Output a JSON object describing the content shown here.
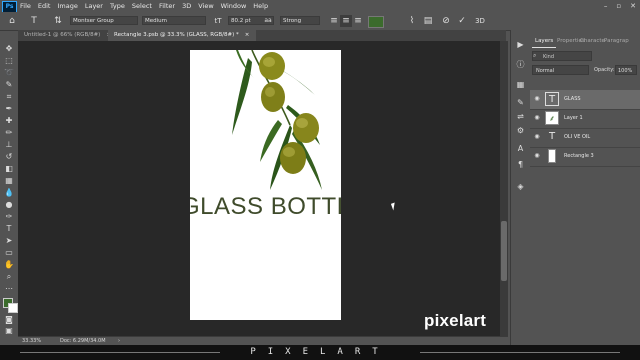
{
  "menubar": {
    "app_badge": "Ps",
    "items": [
      "File",
      "Edit",
      "Image",
      "Layer",
      "Type",
      "Select",
      "Filter",
      "3D",
      "View",
      "Window",
      "Help"
    ]
  },
  "options_bar": {
    "font_family": "Montser",
    "font_group": "Group",
    "font_style": "Medium",
    "font_size": "80.2 pt",
    "antialias": "Strong",
    "font_color": "#3b6b2c"
  },
  "tabs": [
    {
      "label": "Untitled-1 @ 66% (RGB/8#)",
      "close": "×",
      "active": false
    },
    {
      "label": "Rectangle 3.psb @ 33.3% (GLASS, RGB/8#) *",
      "close": "×",
      "active": true
    }
  ],
  "canvas": {
    "headline": "GLASS BOTTLE",
    "background": "#ffffff",
    "text_color": "#3f4b2b"
  },
  "watermark": {
    "text": "pixelart"
  },
  "status": {
    "zoom": "33.33%",
    "doc": "Doc: 6.29M/34.0M",
    "arrow": "›"
  },
  "layers_panel": {
    "tabs": [
      "Layers",
      "Properties",
      "Characte",
      "Paragrap"
    ],
    "kind": "Kind",
    "blend_mode": "Normal",
    "opacity_label": "Opacity:",
    "opacity": "100%",
    "layers": [
      {
        "name": "GLASS",
        "type": "text",
        "selected": true
      },
      {
        "name": "Layer 1",
        "type": "image",
        "selected": false
      },
      {
        "name": "OLI VE OIL",
        "type": "text",
        "selected": false
      },
      {
        "name": "Rectangle 3",
        "type": "shape",
        "selected": false
      }
    ]
  },
  "footer_strip": {
    "text": "PIXELART"
  },
  "accent": "#31a8ff"
}
